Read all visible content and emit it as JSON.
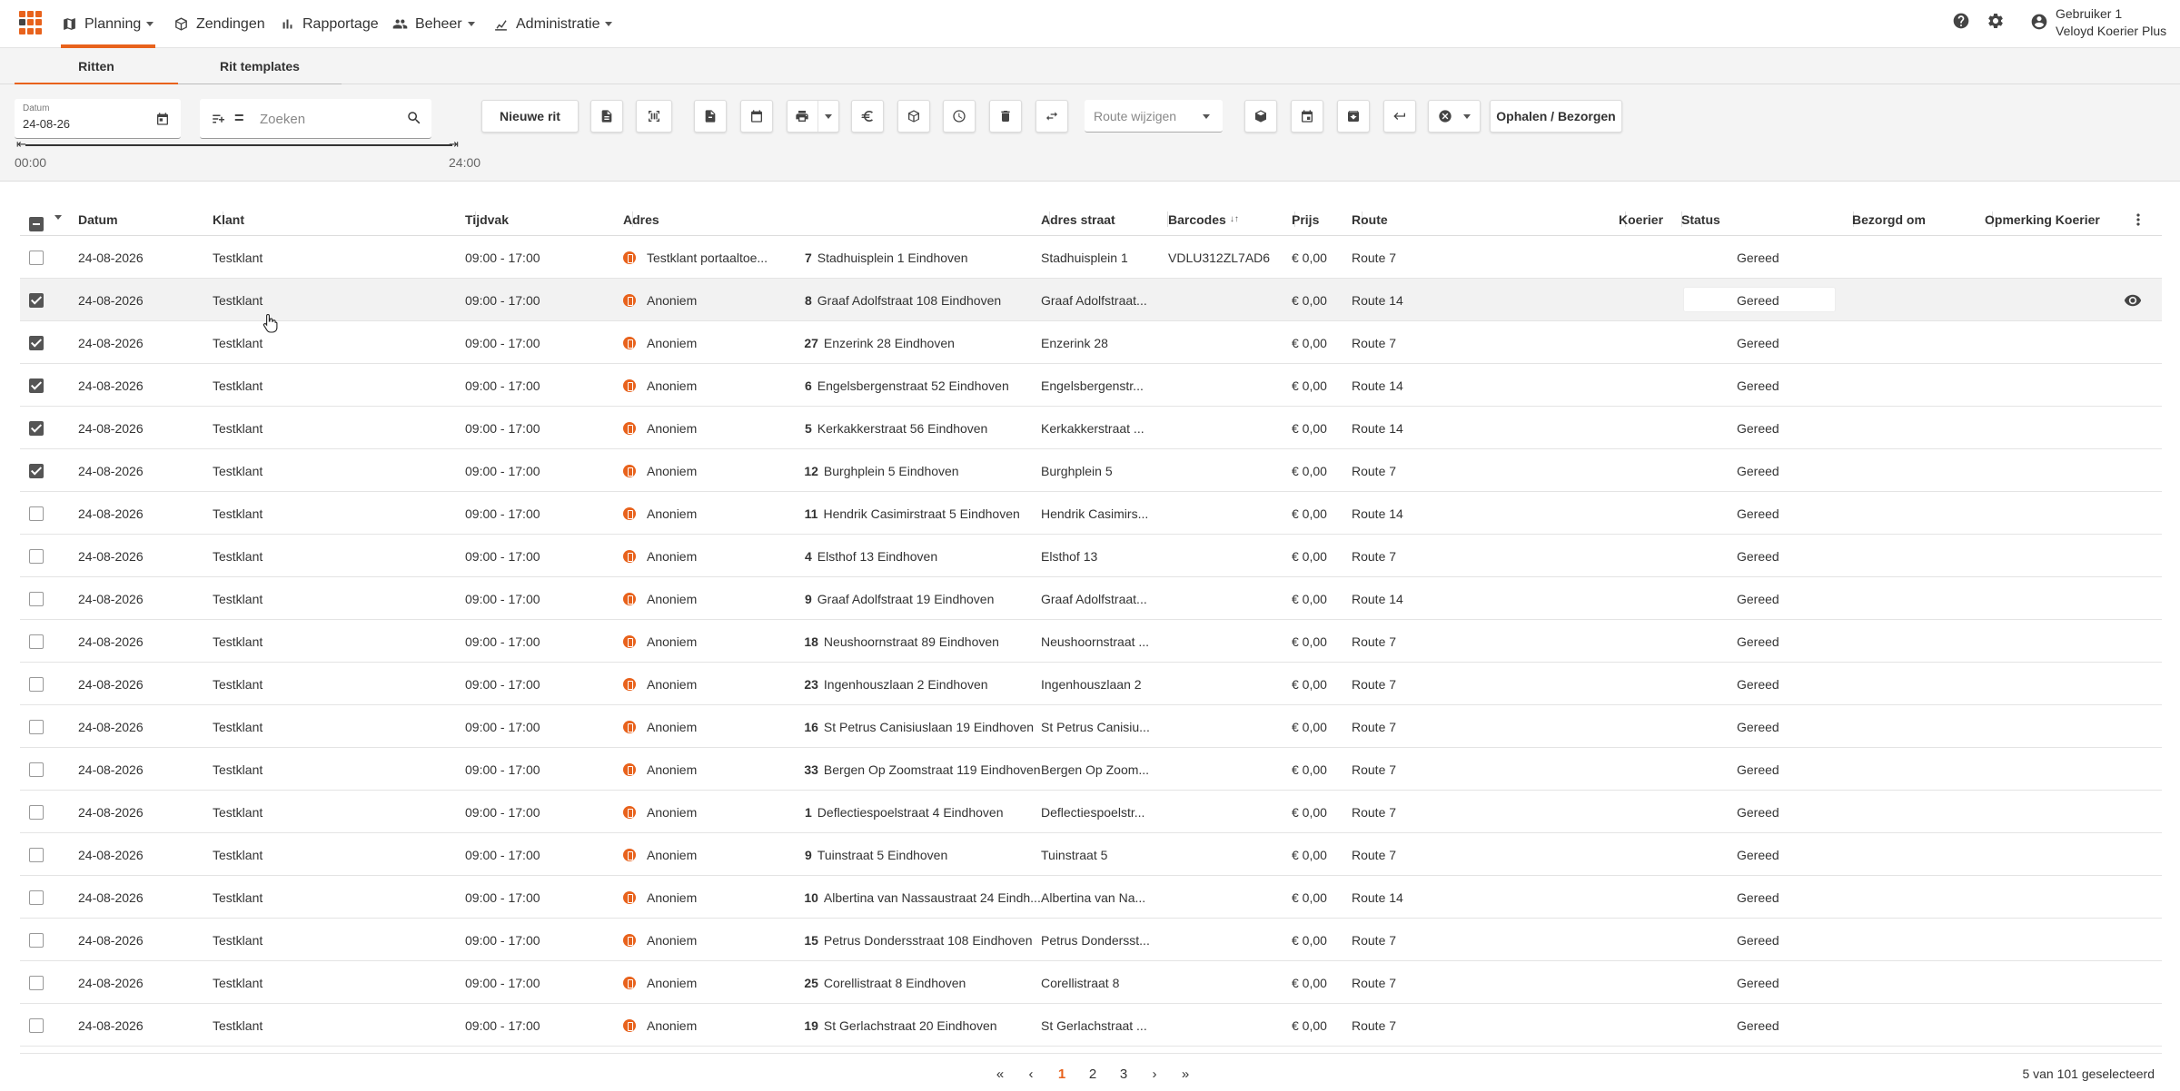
{
  "nav": {
    "items": [
      {
        "label": "Planning",
        "icon": "map-icon"
      },
      {
        "label": "Zendingen",
        "icon": "box-icon"
      },
      {
        "label": "Rapportage",
        "icon": "bar-chart-icon"
      },
      {
        "label": "Beheer",
        "icon": "people-icon"
      },
      {
        "label": "Administratie",
        "icon": "admin-icon"
      }
    ],
    "accent": "#e8621c"
  },
  "user": {
    "name": "Gebruiker 1",
    "company": "Veloyd Koerier Plus"
  },
  "tabs": [
    "Ritten",
    "Rit templates"
  ],
  "toolbar": {
    "date_label": "Datum",
    "date_value": "24-08-26",
    "search_operator": "=",
    "search_placeholder": "Zoeken",
    "new_ride_label": "Nieuwe rit",
    "route_placeholder": "Route wijzigen",
    "pickup_deliver_label": "Ophalen / Bezorgen",
    "time_start": "00:00",
    "time_end": "24:00"
  },
  "columns": [
    "Datum",
    "Klant",
    "Tijdvak",
    "Adres",
    "Adres straat",
    "Barcodes",
    "Prijs",
    "Route",
    "Koerier",
    "Status",
    "Bezorgd om",
    "Opmerking Koerier"
  ],
  "rows": [
    {
      "checked": false,
      "date": "24-08-2026",
      "client": "Testklant",
      "slot": "09:00 - 17:00",
      "recipient": "Testklant portaaltoe...",
      "stop": "7",
      "address": "Stadhuisplein 1 Eindhoven",
      "street": "Stadhuisplein 1",
      "barcode": "VDLU312ZL7AD6",
      "price": "€ 0,00",
      "route": "Route 7",
      "status": "Gereed"
    },
    {
      "checked": true,
      "date": "24-08-2026",
      "client": "Testklant",
      "slot": "09:00 - 17:00",
      "recipient": "Anoniem",
      "stop": "8",
      "address": "Graaf Adolfstraat 108 Eindhoven",
      "street": "Graaf Adolfstraat...",
      "barcode": "",
      "price": "€ 0,00",
      "route": "Route 14",
      "status": "Gereed"
    },
    {
      "checked": true,
      "date": "24-08-2026",
      "client": "Testklant",
      "slot": "09:00 - 17:00",
      "recipient": "Anoniem",
      "stop": "27",
      "address": "Enzerink 28 Eindhoven",
      "street": "Enzerink 28",
      "barcode": "",
      "price": "€ 0,00",
      "route": "Route 7",
      "status": "Gereed"
    },
    {
      "checked": true,
      "date": "24-08-2026",
      "client": "Testklant",
      "slot": "09:00 - 17:00",
      "recipient": "Anoniem",
      "stop": "6",
      "address": "Engelsbergenstraat 52 Eindhoven",
      "street": "Engelsbergenstr...",
      "barcode": "",
      "price": "€ 0,00",
      "route": "Route 14",
      "status": "Gereed"
    },
    {
      "checked": true,
      "date": "24-08-2026",
      "client": "Testklant",
      "slot": "09:00 - 17:00",
      "recipient": "Anoniem",
      "stop": "5",
      "address": "Kerkakkerstraat 56 Eindhoven",
      "street": "Kerkakkerstraat ...",
      "barcode": "",
      "price": "€ 0,00",
      "route": "Route 14",
      "status": "Gereed"
    },
    {
      "checked": true,
      "date": "24-08-2026",
      "client": "Testklant",
      "slot": "09:00 - 17:00",
      "recipient": "Anoniem",
      "stop": "12",
      "address": "Burghplein 5 Eindhoven",
      "street": "Burghplein 5",
      "barcode": "",
      "price": "€ 0,00",
      "route": "Route 7",
      "status": "Gereed"
    },
    {
      "checked": false,
      "date": "24-08-2026",
      "client": "Testklant",
      "slot": "09:00 - 17:00",
      "recipient": "Anoniem",
      "stop": "11",
      "address": "Hendrik Casimirstraat 5 Eindhoven",
      "street": "Hendrik Casimirs...",
      "barcode": "",
      "price": "€ 0,00",
      "route": "Route 14",
      "status": "Gereed"
    },
    {
      "checked": false,
      "date": "24-08-2026",
      "client": "Testklant",
      "slot": "09:00 - 17:00",
      "recipient": "Anoniem",
      "stop": "4",
      "address": "Elsthof 13 Eindhoven",
      "street": "Elsthof 13",
      "barcode": "",
      "price": "€ 0,00",
      "route": "Route 7",
      "status": "Gereed"
    },
    {
      "checked": false,
      "date": "24-08-2026",
      "client": "Testklant",
      "slot": "09:00 - 17:00",
      "recipient": "Anoniem",
      "stop": "9",
      "address": "Graaf Adolfstraat 19 Eindhoven",
      "street": "Graaf Adolfstraat...",
      "barcode": "",
      "price": "€ 0,00",
      "route": "Route 14",
      "status": "Gereed"
    },
    {
      "checked": false,
      "date": "24-08-2026",
      "client": "Testklant",
      "slot": "09:00 - 17:00",
      "recipient": "Anoniem",
      "stop": "18",
      "address": "Neushoornstraat 89 Eindhoven",
      "street": "Neushoornstraat ...",
      "barcode": "",
      "price": "€ 0,00",
      "route": "Route 7",
      "status": "Gereed"
    },
    {
      "checked": false,
      "date": "24-08-2026",
      "client": "Testklant",
      "slot": "09:00 - 17:00",
      "recipient": "Anoniem",
      "stop": "23",
      "address": "Ingenhouszlaan 2 Eindhoven",
      "street": "Ingenhouszlaan 2",
      "barcode": "",
      "price": "€ 0,00",
      "route": "Route 7",
      "status": "Gereed"
    },
    {
      "checked": false,
      "date": "24-08-2026",
      "client": "Testklant",
      "slot": "09:00 - 17:00",
      "recipient": "Anoniem",
      "stop": "16",
      "address": "St Petrus Canisiuslaan 19 Eindhoven",
      "street": "St Petrus Canisiu...",
      "barcode": "",
      "price": "€ 0,00",
      "route": "Route 7",
      "status": "Gereed"
    },
    {
      "checked": false,
      "date": "24-08-2026",
      "client": "Testklant",
      "slot": "09:00 - 17:00",
      "recipient": "Anoniem",
      "stop": "33",
      "address": "Bergen Op Zoomstraat 119 Eindhoven",
      "street": "Bergen Op Zoom...",
      "barcode": "",
      "price": "€ 0,00",
      "route": "Route 7",
      "status": "Gereed"
    },
    {
      "checked": false,
      "date": "24-08-2026",
      "client": "Testklant",
      "slot": "09:00 - 17:00",
      "recipient": "Anoniem",
      "stop": "1",
      "address": "Deflectiespoelstraat 4 Eindhoven",
      "street": "Deflectiespoelstr...",
      "barcode": "",
      "price": "€ 0,00",
      "route": "Route 7",
      "status": "Gereed"
    },
    {
      "checked": false,
      "date": "24-08-2026",
      "client": "Testklant",
      "slot": "09:00 - 17:00",
      "recipient": "Anoniem",
      "stop": "9",
      "address": "Tuinstraat 5 Eindhoven",
      "street": "Tuinstraat 5",
      "barcode": "",
      "price": "€ 0,00",
      "route": "Route 7",
      "status": "Gereed"
    },
    {
      "checked": false,
      "date": "24-08-2026",
      "client": "Testklant",
      "slot": "09:00 - 17:00",
      "recipient": "Anoniem",
      "stop": "10",
      "address": "Albertina van Nassaustraat 24 Eindh...",
      "street": "Albertina van Na...",
      "barcode": "",
      "price": "€ 0,00",
      "route": "Route 14",
      "status": "Gereed"
    },
    {
      "checked": false,
      "date": "24-08-2026",
      "client": "Testklant",
      "slot": "09:00 - 17:00",
      "recipient": "Anoniem",
      "stop": "15",
      "address": "Petrus Dondersstraat 108 Eindhoven",
      "street": "Petrus Dondersst...",
      "barcode": "",
      "price": "€ 0,00",
      "route": "Route 7",
      "status": "Gereed"
    },
    {
      "checked": false,
      "date": "24-08-2026",
      "client": "Testklant",
      "slot": "09:00 - 17:00",
      "recipient": "Anoniem",
      "stop": "25",
      "address": "Corellistraat 8 Eindhoven",
      "street": "Corellistraat 8",
      "barcode": "",
      "price": "€ 0,00",
      "route": "Route 7",
      "status": "Gereed"
    },
    {
      "checked": false,
      "date": "24-08-2026",
      "client": "Testklant",
      "slot": "09:00 - 17:00",
      "recipient": "Anoniem",
      "stop": "19",
      "address": "St Gerlachstraat 20 Eindhoven",
      "street": "St Gerlachstraat ...",
      "barcode": "",
      "price": "€ 0,00",
      "route": "Route 7",
      "status": "Gereed"
    }
  ],
  "pagination": {
    "pages": [
      "1",
      "2",
      "3"
    ],
    "current": "1",
    "selected_text": "5 van 101 geselecteerd"
  }
}
